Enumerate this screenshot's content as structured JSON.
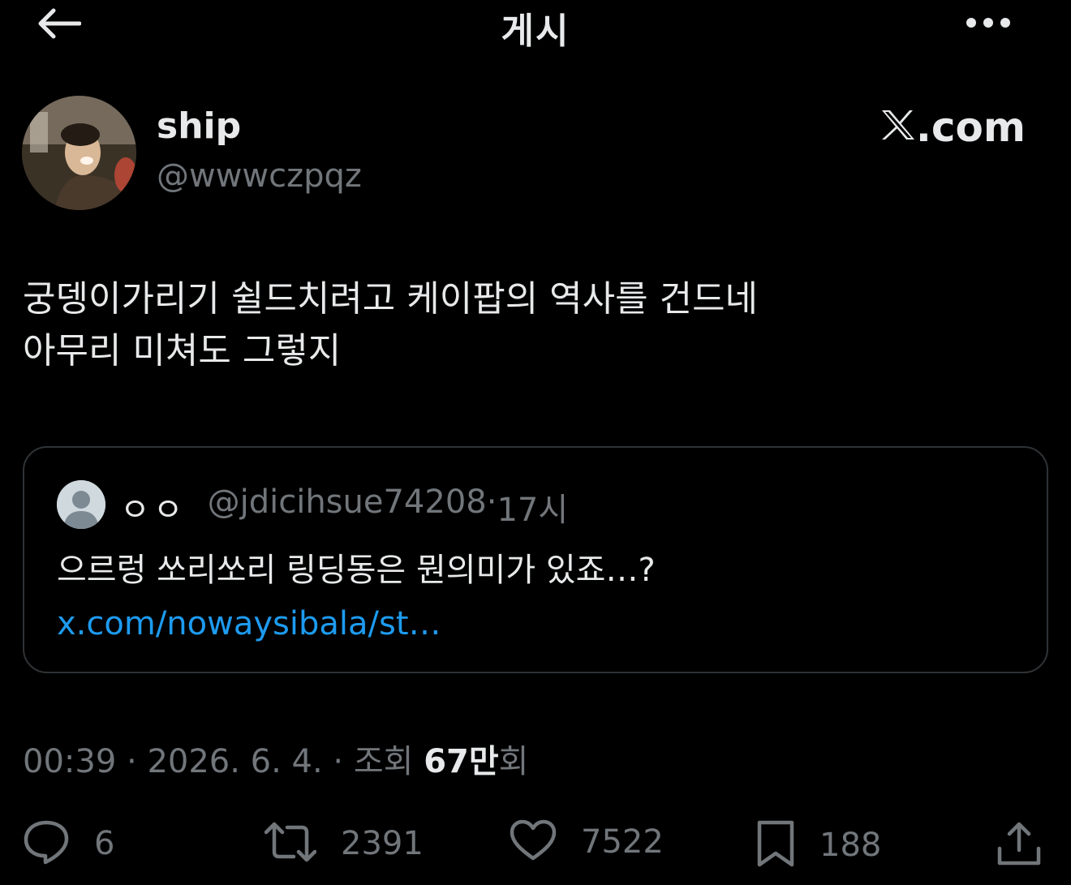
{
  "header": {
    "title": "게시"
  },
  "author": {
    "display_name": "ship",
    "handle": "@wwwczpqz"
  },
  "watermark": {
    "text": ".com"
  },
  "tweet": {
    "lines": [
      "궁뎅이가리기 쉴드치려고 케이팝의 역사를 건드네",
      "아무리 미쳐도 그렇지"
    ]
  },
  "quote": {
    "name": "ㅇㅇ",
    "handle": "@jdicihsue74208",
    "separator": " · ",
    "time": "17시",
    "text": "으르렁 쏘리쏘리 링딩동은 뭔의미가 있죠…? ",
    "link": "x.com/nowaysibala/st…"
  },
  "meta": {
    "time": "00:39",
    "sep1": " · ",
    "date": "2026. 6. 4.",
    "sep2": " · ",
    "views_label": "조회 ",
    "views_count": "67만",
    "views_suffix": "회"
  },
  "actions": {
    "reply_count": "6",
    "retweet_count": "2391",
    "like_count": "7522",
    "bookmark_count": "188"
  },
  "colors": {
    "background": "#000000",
    "text": "#e7e9ea",
    "muted": "#71767b",
    "link": "#1d9bf0",
    "border": "#2f3336"
  }
}
